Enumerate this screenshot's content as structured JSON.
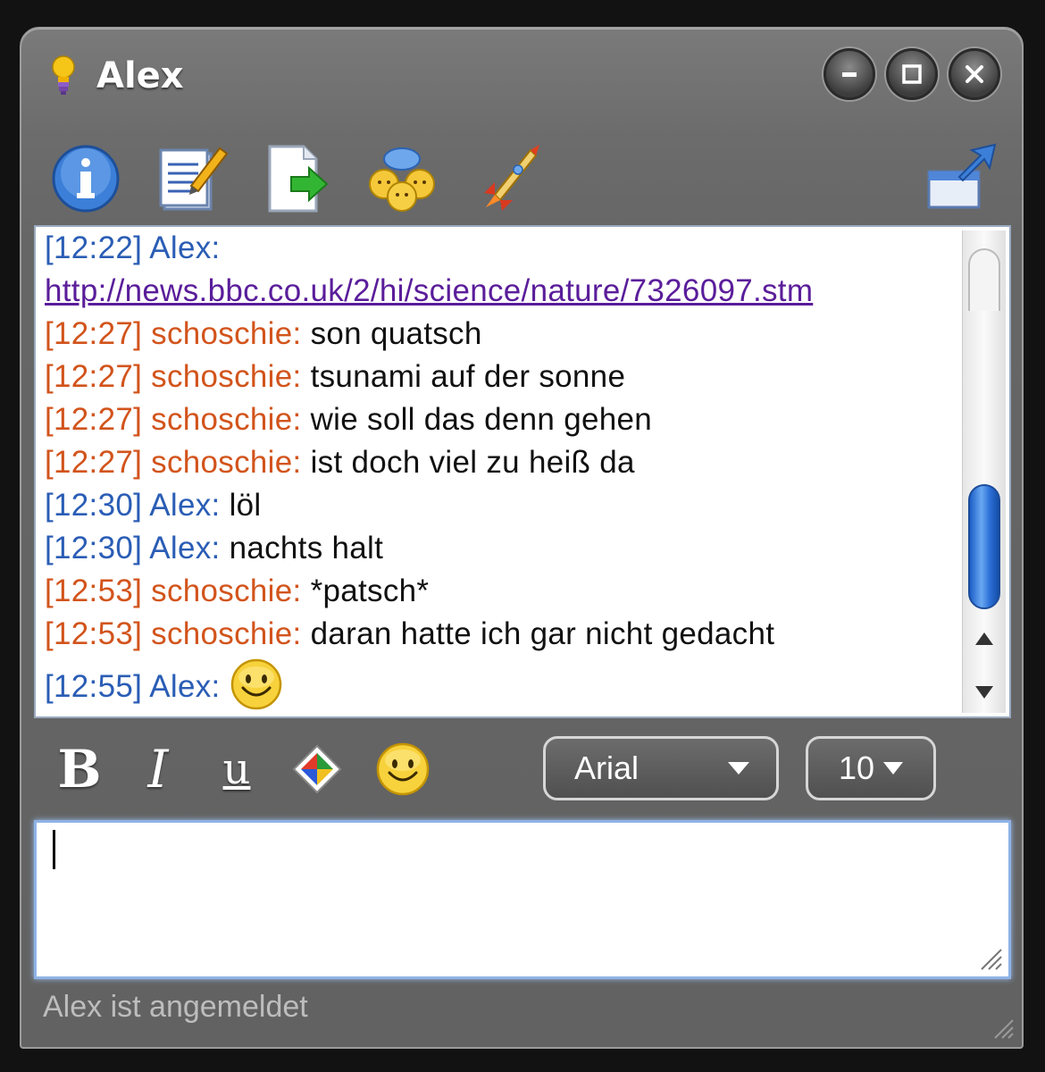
{
  "window": {
    "title": "Alex"
  },
  "toolbar": {
    "icons": [
      "info-icon",
      "edit-notes-icon",
      "send-file-icon",
      "group-chat-icon",
      "rocket-icon",
      "popout-icon"
    ]
  },
  "chat": {
    "messages": [
      {
        "time": "[12:22]",
        "sender": "Alex:",
        "text": "",
        "type": "alex"
      },
      {
        "time": "",
        "sender": "",
        "text": "http://news.bbc.co.uk/2/hi/science/nature/7326097.stm",
        "type": "link"
      },
      {
        "time": "[12:27]",
        "sender": "schoschie:",
        "text": "son quatsch",
        "type": "schoschie"
      },
      {
        "time": "[12:27]",
        "sender": "schoschie:",
        "text": "tsunami auf der sonne",
        "type": "schoschie"
      },
      {
        "time": "[12:27]",
        "sender": "schoschie:",
        "text": "wie soll das denn gehen",
        "type": "schoschie"
      },
      {
        "time": "[12:27]",
        "sender": "schoschie:",
        "text": "ist doch viel zu heiß da",
        "type": "schoschie"
      },
      {
        "time": "[12:30]",
        "sender": "Alex:",
        "text": "löl",
        "type": "alex"
      },
      {
        "time": "[12:30]",
        "sender": "Alex:",
        "text": "nachts halt",
        "type": "alex"
      },
      {
        "time": "[12:53]",
        "sender": "schoschie:",
        "text": "*patsch*",
        "type": "schoschie"
      },
      {
        "time": "[12:53]",
        "sender": "schoschie:",
        "text": "daran hatte ich gar nicht gedacht",
        "type": "schoschie"
      },
      {
        "time": "[12:55]",
        "sender": "Alex:",
        "text": "",
        "type": "alex",
        "emoticon": "smiley-icon"
      }
    ]
  },
  "format": {
    "bold_label": "B",
    "italic_label": "I",
    "underline_label": "u",
    "font_value": "Arial",
    "size_value": "10"
  },
  "input": {
    "value": ""
  },
  "status": {
    "text": "Alex ist angemeldet"
  },
  "colors": {
    "alex": "#2a5db5",
    "schoschie": "#d2541c",
    "link": "#5a1d9a"
  }
}
